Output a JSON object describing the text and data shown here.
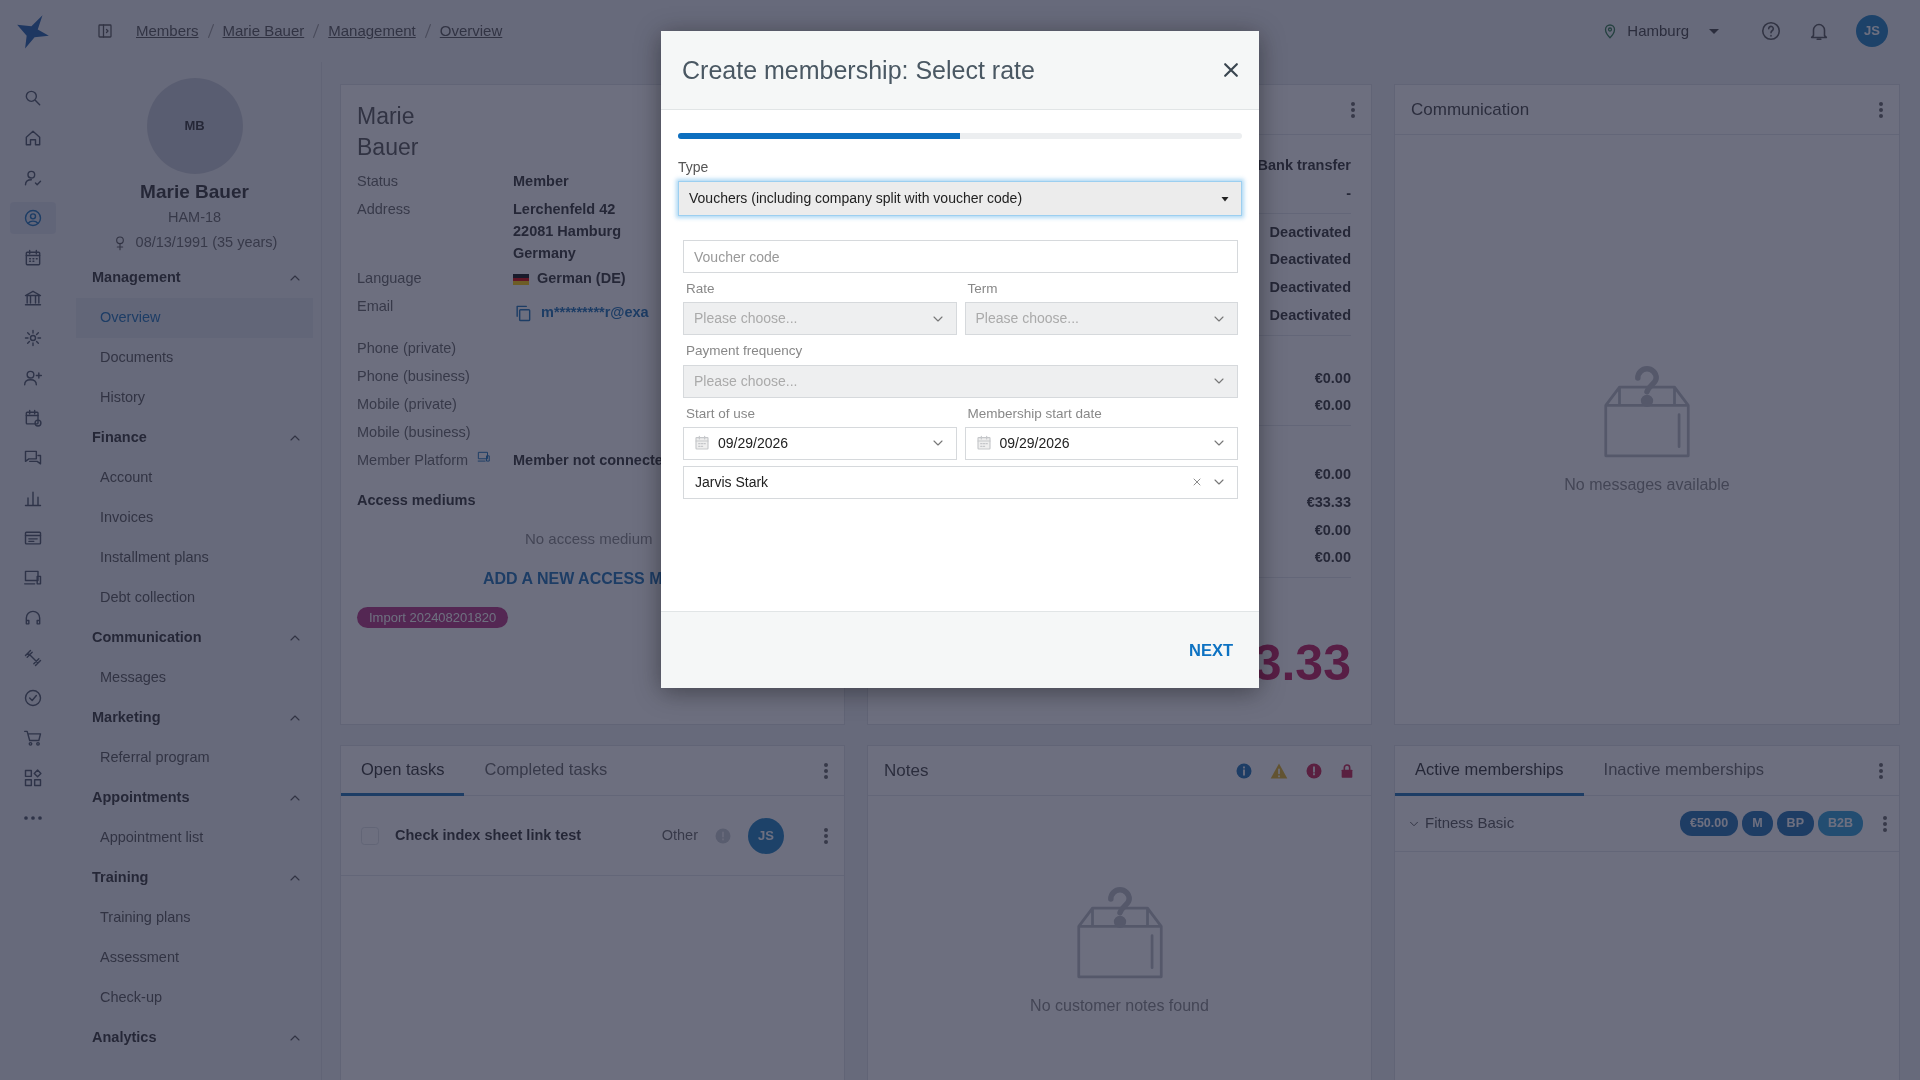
{
  "topbar": {
    "breadcrumbs": [
      "Members",
      "Marie Bauer",
      "Management",
      "Overview"
    ],
    "location": "Hamburg",
    "user_initials": "JS"
  },
  "rail": [
    {
      "selected": false
    },
    {
      "selected": false
    },
    {
      "selected": false
    },
    {
      "selected": true
    },
    {
      "selected": false
    },
    {
      "selected": false
    },
    {
      "selected": false
    },
    {
      "selected": false
    },
    {
      "selected": false
    },
    {
      "selected": false
    },
    {
      "selected": false
    },
    {
      "selected": false
    },
    {
      "selected": false
    },
    {
      "selected": false
    },
    {
      "selected": false
    },
    {
      "selected": false
    },
    {
      "selected": false
    },
    {
      "selected": false
    },
    {
      "selected": false
    }
  ],
  "profile": {
    "initials": "MB",
    "name": "Marie Bauer",
    "member_id": "HAM-18",
    "birth": "08/13/1991 (35 years)"
  },
  "nav": [
    {
      "title": "Management",
      "expanded": true,
      "items": [
        {
          "label": "Overview",
          "selected": true
        },
        {
          "label": "Documents",
          "selected": false
        },
        {
          "label": "History",
          "selected": false
        }
      ]
    },
    {
      "title": "Finance",
      "expanded": true,
      "items": [
        {
          "label": "Account",
          "selected": false
        },
        {
          "label": "Invoices",
          "selected": false
        },
        {
          "label": "Installment plans",
          "selected": false
        },
        {
          "label": "Debt collection",
          "selected": false
        }
      ]
    },
    {
      "title": "Communication",
      "expanded": true,
      "items": [
        {
          "label": "Messages",
          "selected": false
        }
      ]
    },
    {
      "title": "Marketing",
      "expanded": true,
      "items": [
        {
          "label": "Referral program",
          "selected": false
        }
      ]
    },
    {
      "title": "Appointments",
      "expanded": true,
      "items": [
        {
          "label": "Appointment list",
          "selected": false
        }
      ]
    },
    {
      "title": "Training",
      "expanded": true,
      "items": [
        {
          "label": "Training plans",
          "selected": false
        },
        {
          "label": "Assessment",
          "selected": false
        },
        {
          "label": "Check-up",
          "selected": false
        }
      ]
    },
    {
      "title": "Analytics",
      "expanded": true
    }
  ],
  "details": {
    "name": "Marie Bauer",
    "fields": [
      {
        "kind": "text",
        "label": "Status",
        "value": "Member"
      },
      {
        "kind": "lines",
        "label": "Address",
        "lines": [
          "Lerchenfeld 42",
          "22081 Hamburg",
          "Germany"
        ]
      },
      {
        "kind": "flag",
        "label": "Language",
        "value": "German (DE)"
      },
      {
        "kind": "email",
        "label": "Email",
        "value": "m*********r@exa"
      },
      {
        "kind": "empty",
        "label": "Phone (private)"
      },
      {
        "kind": "empty",
        "label": "Phone (business)"
      },
      {
        "kind": "empty",
        "label": "Mobile (private)"
      },
      {
        "kind": "empty",
        "label": "Mobile (business)"
      },
      {
        "kind": "platform",
        "label": "Member Platform",
        "value": "Member not connecte"
      }
    ],
    "access_title": "Access mediums",
    "access_empty": "No access medium",
    "access_link": "ADD A NEW ACCESS M",
    "tag": "Import 202408201820"
  },
  "finance": {
    "groups": [
      [
        "Bank transfer",
        "-"
      ],
      [
        "Deactivated",
        "Deactivated",
        "Deactivated",
        "Deactivated"
      ],
      [
        "€0.00",
        "€0.00"
      ],
      [
        "€0.00",
        "€33.33",
        "€0.00",
        "€0.00"
      ]
    ],
    "total": "3.33"
  },
  "communication": {
    "title": "Communication",
    "empty": "No messages available"
  },
  "tasks": {
    "tabs": [
      {
        "label": "Open tasks",
        "selected": true
      },
      {
        "label": "Completed tasks",
        "selected": false
      }
    ],
    "rows": [
      {
        "title": "Check index sheet link test",
        "checked": false,
        "category": "Other",
        "assignee": "JS"
      }
    ]
  },
  "notes": {
    "title": "Notes",
    "empty": "No customer notes found"
  },
  "memberships": {
    "tabs": [
      {
        "label": "Active memberships",
        "selected": true
      },
      {
        "label": "Inactive memberships",
        "selected": false
      }
    ],
    "rows": [
      {
        "name": "Fitness Basic",
        "expanded": false,
        "badges": [
          {
            "text": "€50.00",
            "kind": "primary"
          },
          {
            "text": "M",
            "kind": "primary"
          },
          {
            "text": "BP",
            "kind": "primary"
          },
          {
            "text": "B2B",
            "kind": "info"
          }
        ]
      }
    ]
  },
  "modal": {
    "title": "Create membership: Select rate",
    "progress": {
      "level": 0.5
    },
    "rows": [
      [
        {
          "kind": "native-select",
          "label": "Type",
          "value": "Vouchers (including company split with voucher code)",
          "disabled": false,
          "focused": true
        }
      ],
      [
        {
          "kind": "input",
          "placeholder": "Voucher code",
          "disabled": false,
          "focused": false
        }
      ],
      [
        {
          "kind": "select",
          "label": "Rate",
          "placeholder": "Please choose...",
          "disabled": true,
          "focused": false
        },
        {
          "kind": "select",
          "label": "Term",
          "placeholder": "Please choose...",
          "disabled": true,
          "focused": false
        }
      ],
      [
        {
          "kind": "select",
          "label": "Payment frequency",
          "placeholder": "Please choose...",
          "disabled": true,
          "focused": false
        }
      ],
      [
        {
          "kind": "date",
          "label": "Start of use",
          "value": "09/29/2026",
          "disabled": false,
          "focused": false
        },
        {
          "kind": "date",
          "label": "Membership start date",
          "value": "09/29/2026",
          "disabled": false,
          "focused": false
        }
      ],
      [
        {
          "kind": "person",
          "value": "Jarvis Stark",
          "disabled": false,
          "focused": false
        }
      ]
    ],
    "next": "NEXT"
  }
}
